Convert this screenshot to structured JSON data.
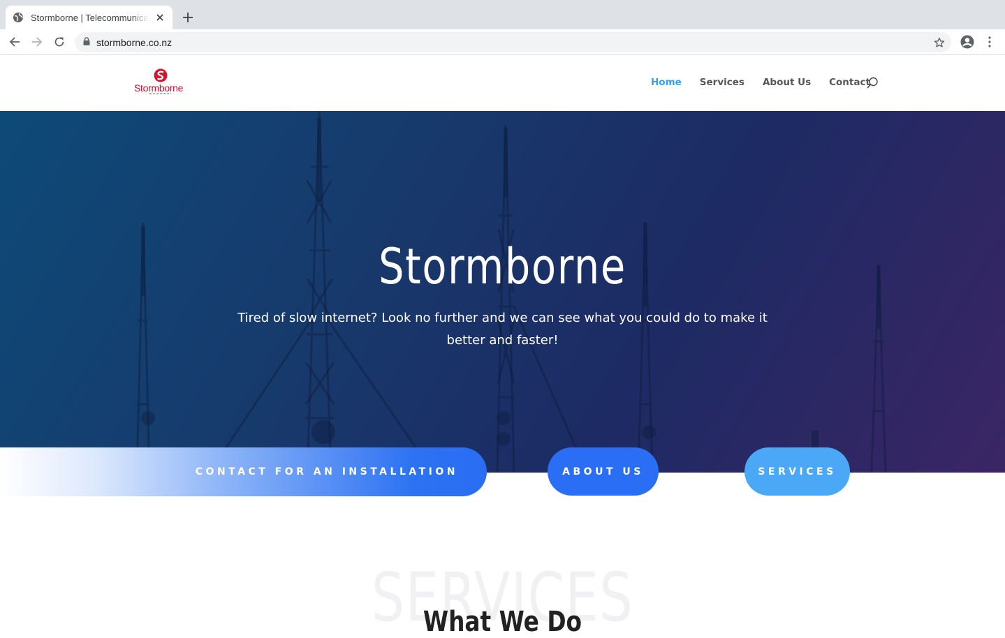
{
  "browser": {
    "tab_title": "Stormborne | Telecommunications",
    "url": "stormborne.co.nz",
    "icons": [
      "globe-icon",
      "close-icon",
      "plus-icon",
      "back-icon",
      "forward-icon",
      "reload-icon",
      "lock-icon",
      "star-icon",
      "account-icon",
      "menu-icon"
    ]
  },
  "header": {
    "logo_text": "Stormborne",
    "nav": [
      {
        "label": "Home",
        "active": true
      },
      {
        "label": "Services",
        "active": false
      },
      {
        "label": "About Us",
        "active": false
      },
      {
        "label": "Contact",
        "active": false
      }
    ],
    "active_color": "#2ea3f2"
  },
  "hero": {
    "title": "Stormborne",
    "subtitle": "Tired of slow internet? Look no further and we can see what you could do to make it better and faster!"
  },
  "cta": {
    "contact_label": "CONTACT FOR AN INSTALLATION",
    "about_label": "ABOUT US",
    "services_label": "SERVICES"
  },
  "services_section": {
    "background_text": "SERVICES",
    "heading": "What We Do"
  }
}
